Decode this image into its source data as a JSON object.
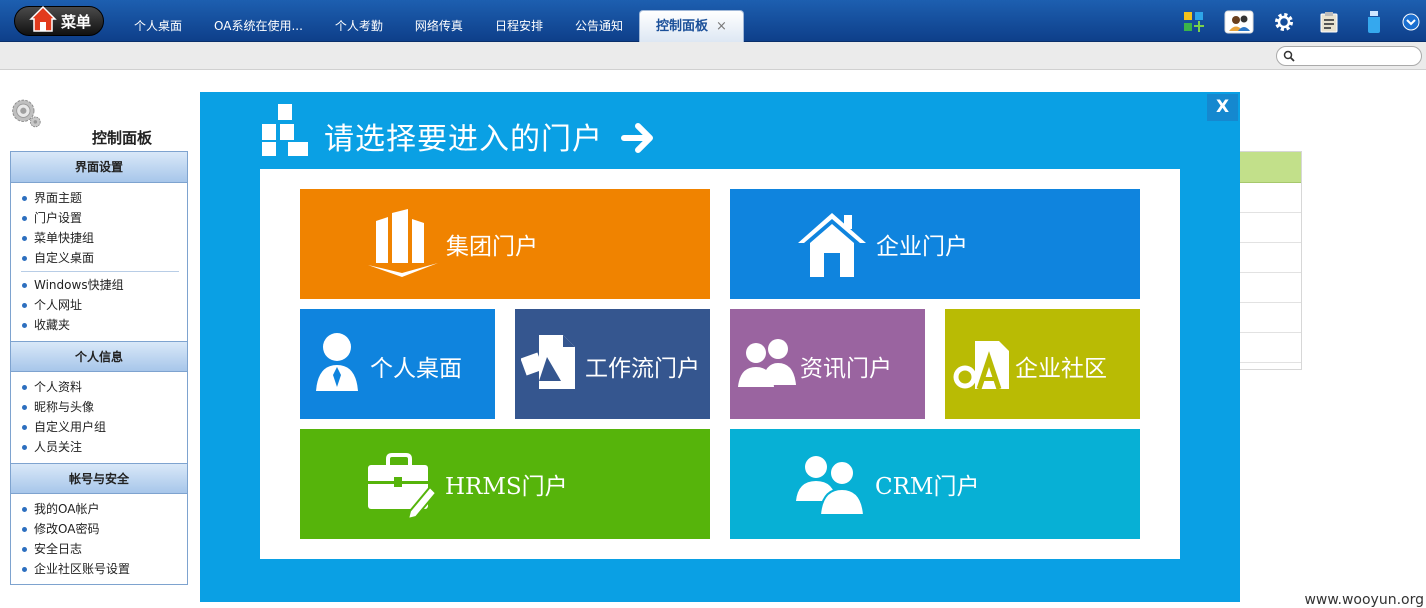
{
  "topbar": {
    "menu_label": "菜单",
    "tabs": [
      {
        "label": "个人桌面"
      },
      {
        "label": "OA系统在使用..."
      },
      {
        "label": "个人考勤"
      },
      {
        "label": "网络传真"
      },
      {
        "label": "日程安排"
      },
      {
        "label": "公告通知"
      },
      {
        "label": "控制面板",
        "active": true
      }
    ],
    "tab_close": "×",
    "icons": [
      "apps-icon",
      "user-switch-icon",
      "gear-icon",
      "clipboard-icon",
      "bottle-icon",
      "chevron-down-icon"
    ]
  },
  "search": {
    "placeholder": "",
    "value": ""
  },
  "page": {
    "title": "控制面板",
    "sections": [
      {
        "title": "界面设置",
        "items": [
          "界面主题",
          "门户设置",
          "菜单快捷组",
          "自定义桌面"
        ],
        "items2": [
          "Windows快捷组",
          "个人网址",
          "收藏夹"
        ]
      },
      {
        "title": "个人信息",
        "items": [
          "个人资料",
          "昵称与头像",
          "自定义用户组",
          "人员关注"
        ]
      },
      {
        "title": "帐号与安全",
        "items": [
          "我的OA帐户",
          "修改OA密码",
          "安全日志",
          "企业社区账号设置"
        ]
      }
    ]
  },
  "modal": {
    "title": "请选择要进入的门户",
    "close_label": "X",
    "tiles": [
      {
        "label": "集团门户",
        "color": "#f08300",
        "icon": "building-icon"
      },
      {
        "label": "企业门户",
        "color": "#0f84de",
        "icon": "house-icon"
      },
      {
        "label": "个人桌面",
        "color": "#0f84de",
        "icon": "person-icon"
      },
      {
        "label": "工作流门户",
        "color": "#35568f",
        "icon": "workflow-icon"
      },
      {
        "label": "资讯门户",
        "color": "#9a64a0",
        "icon": "people-icon"
      },
      {
        "label": "企业社区",
        "color": "#b9bb04",
        "icon": "oa-doc-icon"
      },
      {
        "label": "HRMS门户",
        "color": "#56b40b",
        "icon": "briefcase-icon"
      },
      {
        "label": "CRM门户",
        "color": "#07b0d5",
        "icon": "group-icon"
      }
    ]
  },
  "colors": {
    "modal_bg": "#0aa0e4",
    "topbar": "#1d5fb0",
    "sidebar_head": "#a7c6ea",
    "table_head": "#c2e08a"
  },
  "watermark": "www.wooyun.org"
}
